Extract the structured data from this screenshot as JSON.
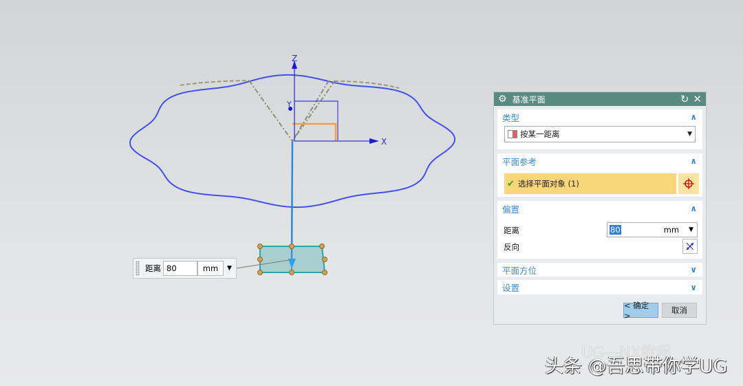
{
  "viewport": {
    "axis_x": "X",
    "axis_y": "Y",
    "axis_z": "Z"
  },
  "dialog": {
    "title": "基准平面",
    "sections": {
      "type": {
        "label": "类型",
        "value": "按某一距离"
      },
      "plane_ref": {
        "label": "平面参考",
        "select_label": "选择平面对象 (1)"
      },
      "offset": {
        "label": "偏置",
        "distance_label": "距离",
        "distance_value": "80",
        "unit": "mm",
        "reverse_label": "反向"
      },
      "orientation": {
        "label": "平面方位"
      },
      "settings": {
        "label": "设置"
      }
    },
    "ok": "< 确定 >",
    "cancel": "取消"
  },
  "float_input": {
    "label": "距离",
    "value": "80",
    "unit": "mm"
  },
  "watermark": {
    "main": "头条 @吾思带你学UG",
    "secondary": "UG—NX教程"
  },
  "colors": {
    "title_bar": "#588a80",
    "section_header": "#3f8bc6",
    "selection": "#fad67a",
    "ok_button": "#9fcdea",
    "curve": "#3b4ce8"
  }
}
